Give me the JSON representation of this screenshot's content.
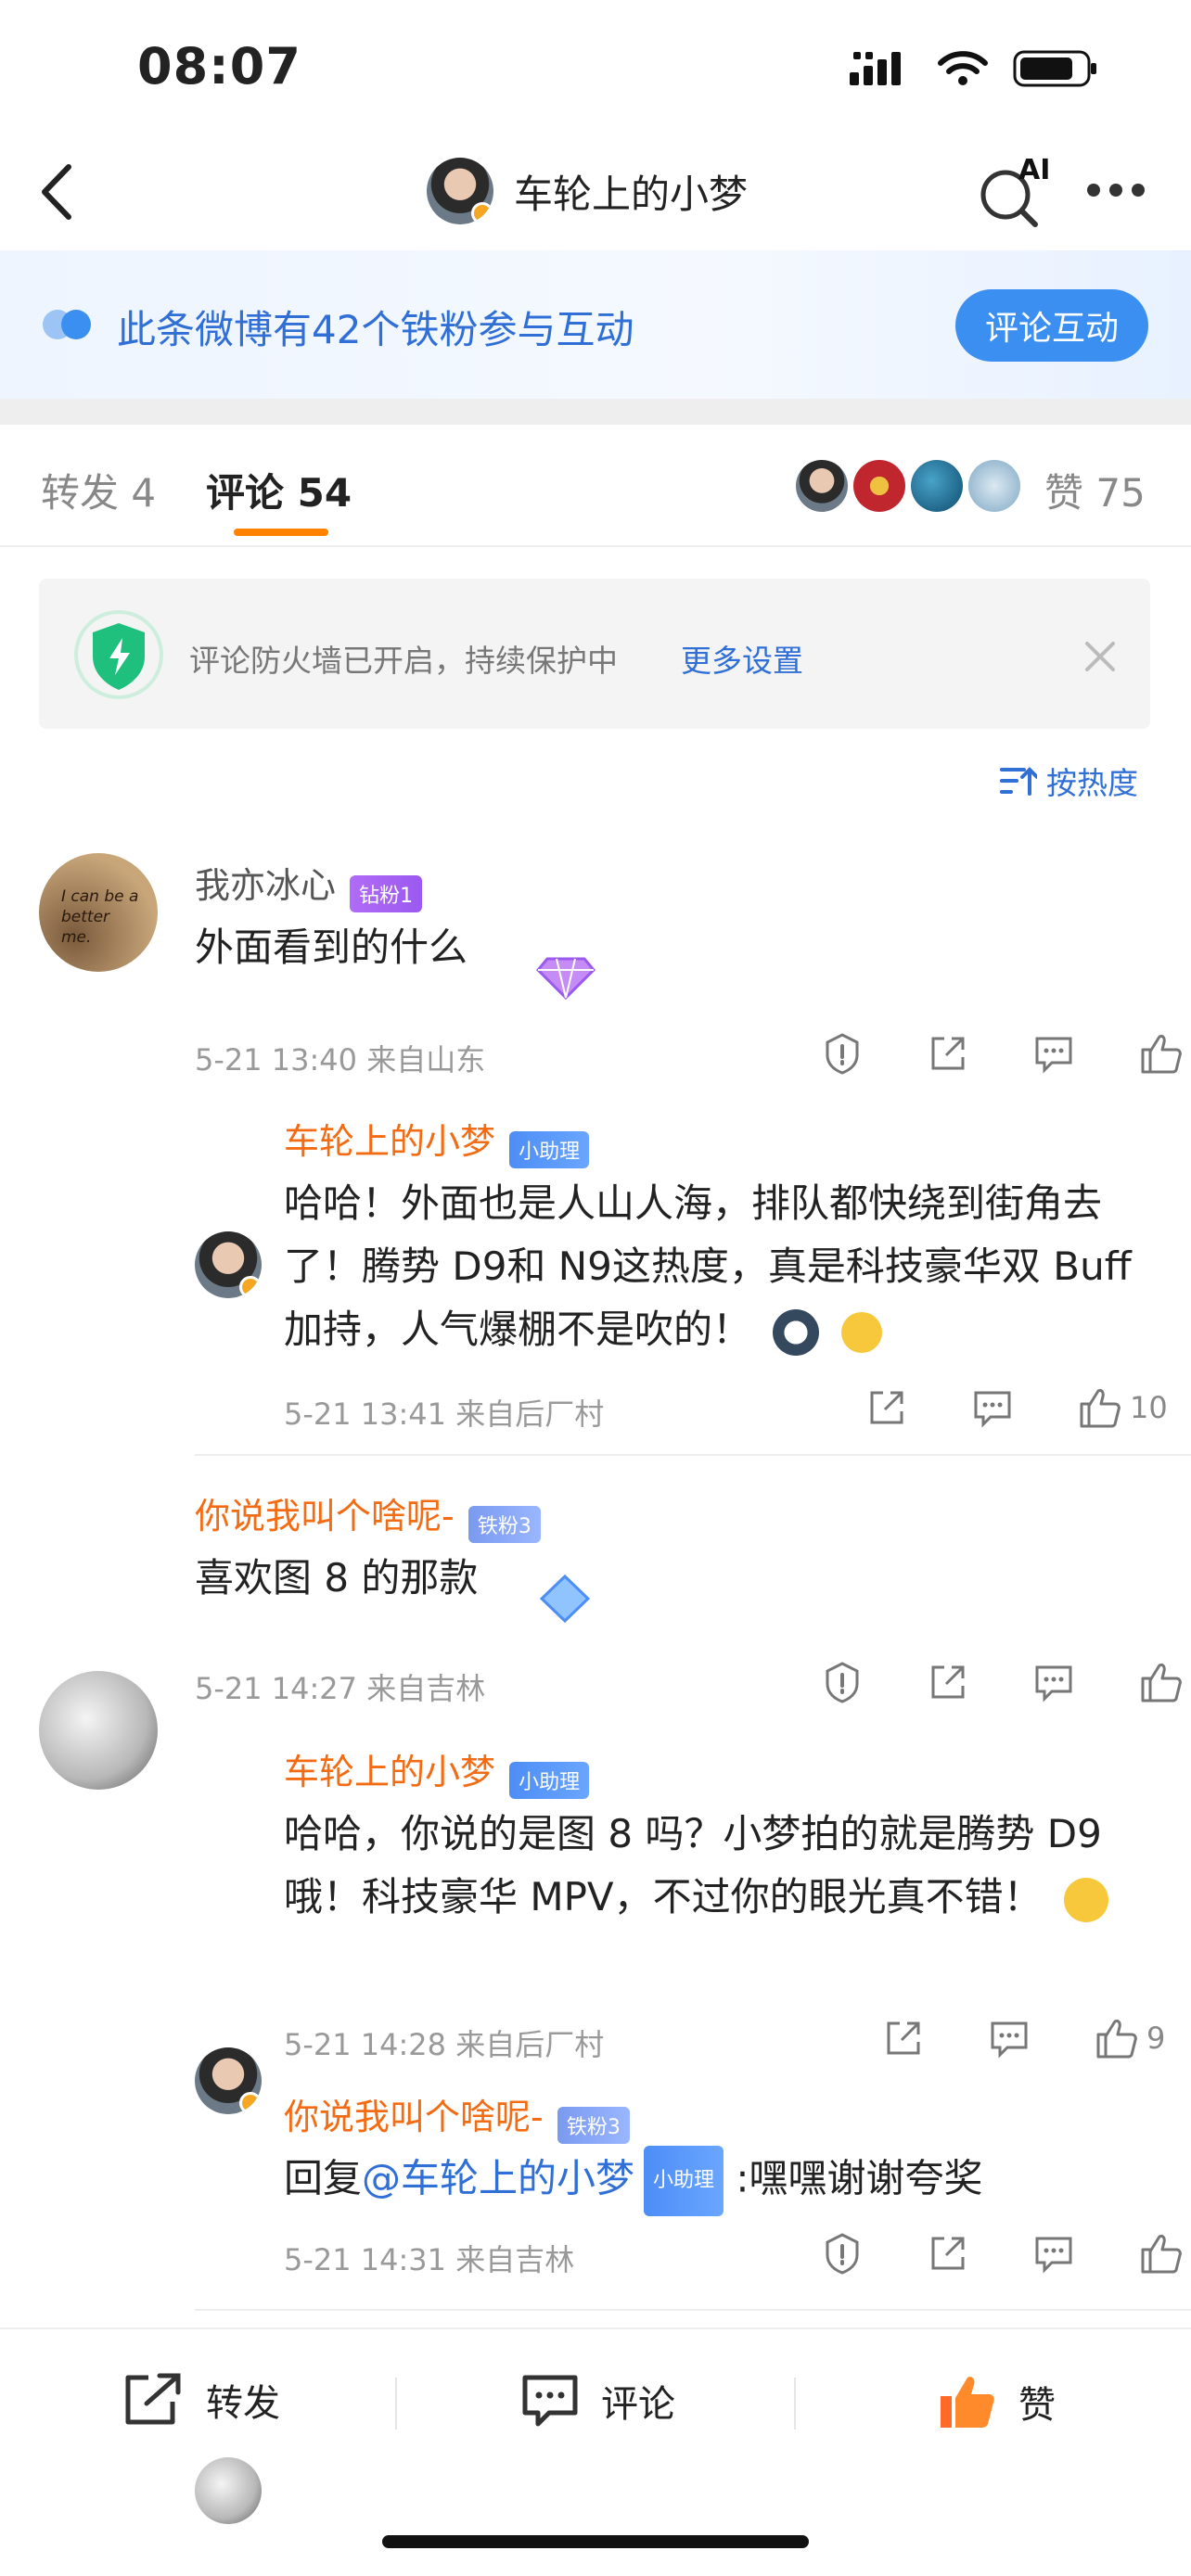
{
  "status_bar": {
    "time": "08:07"
  },
  "nav": {
    "title": "车轮上的小梦",
    "ai_label": "AI"
  },
  "banner": {
    "text": "此条微博有42个铁粉参与互动",
    "button": "评论互动"
  },
  "tabs": {
    "forward": "转发 4",
    "comment": "评论 54",
    "like": "赞 75"
  },
  "firewall": {
    "text": "评论防火墙已开启，持续保护中",
    "link": "更多设置"
  },
  "sort": {
    "label": "按热度"
  },
  "comments": [
    {
      "user": "我亦冰心",
      "badge": "钻粉1",
      "text": "外面看到的什么",
      "meta": "5-21 13:40  来自山东",
      "avatar_text": "I can be a better me.",
      "reply": {
        "user": "车轮上的小梦",
        "badge": "小助理",
        "text": "哈哈！外面也是人山人海，排队都快绕到街角去了！腾势 D9和 N9这热度，真是科技豪华双 Buff加持，人气爆棚不是吹的！",
        "meta": "5-21 13:41  来自后厂村",
        "likes": "10"
      }
    },
    {
      "user": "你说我叫个啥呢-",
      "badge": "铁粉3",
      "text": "喜欢图 8 的那款",
      "meta": "5-21 14:27  来自吉林",
      "reply": {
        "user": "车轮上的小梦",
        "badge": "小助理",
        "text": "哈哈，你说的是图 8 吗？小梦拍的就是腾势 D9哦！科技豪华 MPV，不过你的眼光真不错！",
        "meta": "5-21 14:28  来自后厂村",
        "likes": "9"
      },
      "reply2": {
        "user": "你说我叫个啥呢-",
        "badge": "铁粉3",
        "prefix": "回复",
        "mention": "@车轮上的小梦",
        "mention_badge": "小助理",
        "text": ":嘿嘿谢谢夸奖",
        "meta": "5-21 14:31  来自吉林"
      }
    }
  ],
  "bottom_bar": {
    "forward": "转发",
    "comment": "评论",
    "like": "赞"
  },
  "colors": {
    "accent": "#ff8200",
    "link": "#2f6fd6",
    "username_orange": "#f36b12"
  }
}
